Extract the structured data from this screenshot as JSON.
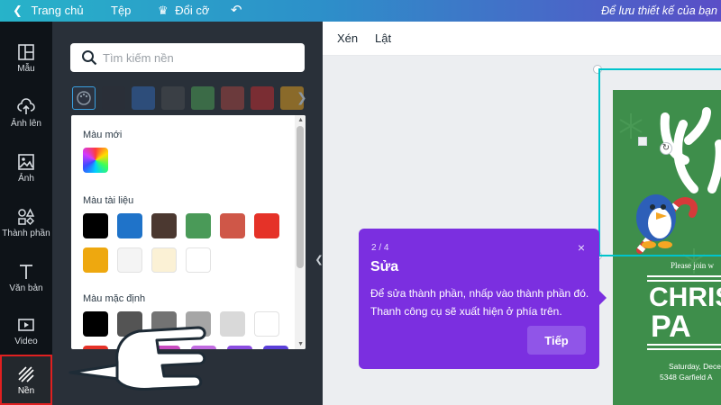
{
  "topbar": {
    "home": "Trang chủ",
    "file": "Tệp",
    "resize": "Đổi cỡ",
    "notice": "Để lưu thiết kế của bạn"
  },
  "leftnav": [
    {
      "label": "Mẫu",
      "icon": "templates-icon"
    },
    {
      "label": "Ảnh lên",
      "icon": "upload-icon"
    },
    {
      "label": "Ảnh",
      "icon": "photo-icon"
    },
    {
      "label": "Thành phần",
      "icon": "elements-icon"
    },
    {
      "label": "Văn bản",
      "icon": "text-icon"
    },
    {
      "label": "Video",
      "icon": "video-icon"
    },
    {
      "label": "Nền",
      "icon": "background-icon",
      "active": true
    }
  ],
  "panel": {
    "search_placeholder": "Tìm kiếm nền",
    "swatches": [
      "#2a2f38",
      "#2d4d7a",
      "#3a3f45",
      "#3b6b47",
      "#6b3a3c",
      "#7a2d33",
      "#8a6a2a"
    ],
    "sections": {
      "new_color": "Màu mới",
      "document_colors": "Màu tài liệu",
      "default_colors": "Màu mặc định"
    },
    "document_colors": [
      "#000000",
      "#1f73c9",
      "#4b3830",
      "#4a9a58",
      "#cf5748",
      "#e53228",
      "#eea80f",
      "#f4f4f4",
      "#fbf1d5",
      "#ffffff"
    ],
    "default_colors": [
      "#000000",
      "#545454",
      "#737373",
      "#a6a6a6",
      "#d9d9d9",
      "#ffffff"
    ]
  },
  "toolbar": {
    "crop": "Xén",
    "flip": "Lật"
  },
  "tooltip": {
    "step": "2 / 4",
    "title": "Sửa",
    "body": "Để sửa thành phần, nhấp vào thành phần đó. Thanh công cụ sẽ xuất hiện ở phía trên.",
    "next": "Tiếp",
    "close": "×"
  },
  "design": {
    "subtitle": "Please join w",
    "title_line1": "CHRIS",
    "title_line2": "PA",
    "date": "Saturday, Dece",
    "address": "5348 Garfield A"
  },
  "colors": {
    "accent": "#00c4cc",
    "tooltip": "#7b2fe0",
    "panel": "#293039",
    "nav": "#0e1318",
    "design_bg": "#3e8e4b"
  }
}
